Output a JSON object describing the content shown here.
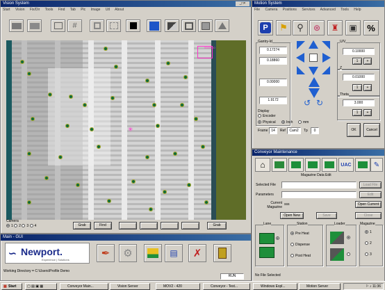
{
  "main_window": {
    "title": "Vision System",
    "menu": [
      "Start",
      "Vision",
      "Fix/Dir",
      "Tools",
      "Find",
      "Tab",
      "Pic",
      "Image",
      "Utl",
      "About"
    ],
    "camera_label": "Camera",
    "camera_options": [
      "1",
      "2",
      "3",
      "4"
    ],
    "bottom_buttons": [
      "Grab",
      "Find",
      "",
      "",
      "",
      "",
      "Grab"
    ],
    "magenta_text": "0000000"
  },
  "motion_window": {
    "title": "Motion System",
    "menu": [
      "File",
      "Camera",
      "Positions",
      "Services",
      "Advanced",
      "Tools",
      "Help"
    ],
    "gantry_label": "Gantry-Id",
    "x_value": "0.17274",
    "y_value": "0.18860",
    "z_value": "0.00000",
    "theta_value": "1.9172",
    "uv_label": "U/V",
    "uv_value": "0.10000",
    "z_label": "Z",
    "z_step": "0.01000",
    "theta_label": "Theta",
    "theta_step": "3.000",
    "step_btns": [
      "1",
      "+"
    ],
    "display_label": "Display",
    "encoder": "Encoder",
    "physical": "Physical",
    "inch": "Inch",
    "mm": "mm",
    "frame_label": "Frame",
    "frame_value": "14",
    "ref_label": "Ref",
    "ref_value": "Cam2",
    "tp_label": "Tp",
    "tp_value": "0",
    "ok_label": "OK",
    "cancel_label": "Cancel"
  },
  "conveyor_window": {
    "title": "Conveyor Maintenance",
    "section": "Magazine Data Edit",
    "selected_file_label": "Selected File",
    "parameters_label": "Parameters",
    "current_magazine_label": "Current Magazine",
    "current_magazine_value": "sss",
    "load_file": "Load File",
    "edit": "Edit",
    "open_current": "Open Current",
    "open_new": "Open New",
    "save": "Save",
    "close": "Close",
    "lane_label": "Lane",
    "station_label": "Station",
    "loader_label": "Loader",
    "magazine_label": "Magazine",
    "station_options": [
      "Pre Heat",
      "Dispense",
      "Post Heat"
    ],
    "magazine_options": [
      "1",
      "2",
      "3"
    ],
    "no_file": "No File Selected"
  },
  "bottom_window": {
    "title": "Main - GUI",
    "logo_text": "Newport.",
    "logo_sub": "Experience | Solutions",
    "working_dir": "Working Directory = C:\\Users\\Profile Demo",
    "status_value": "RUN"
  },
  "taskbar": {
    "start": "Start",
    "tasks": [
      "Conveyor Main...",
      "Vision Server",
      "MOV2 - 420",
      "Conveyor - Test...",
      "Windows Expl...",
      "Motion Server"
    ],
    "clock": "11:36"
  },
  "colors": {
    "desktop": "#3a6ea5",
    "title_dark": "#0a246a",
    "panel": "#d4d0c8",
    "board_green": "#5f6d28",
    "dot": "#0f6a3a",
    "magenta": "#ff33cc"
  },
  "icons": [
    "program-icon",
    "search-icon",
    "gauge-icon",
    "tool-icon",
    "camera-icon",
    "percent-icon"
  ]
}
